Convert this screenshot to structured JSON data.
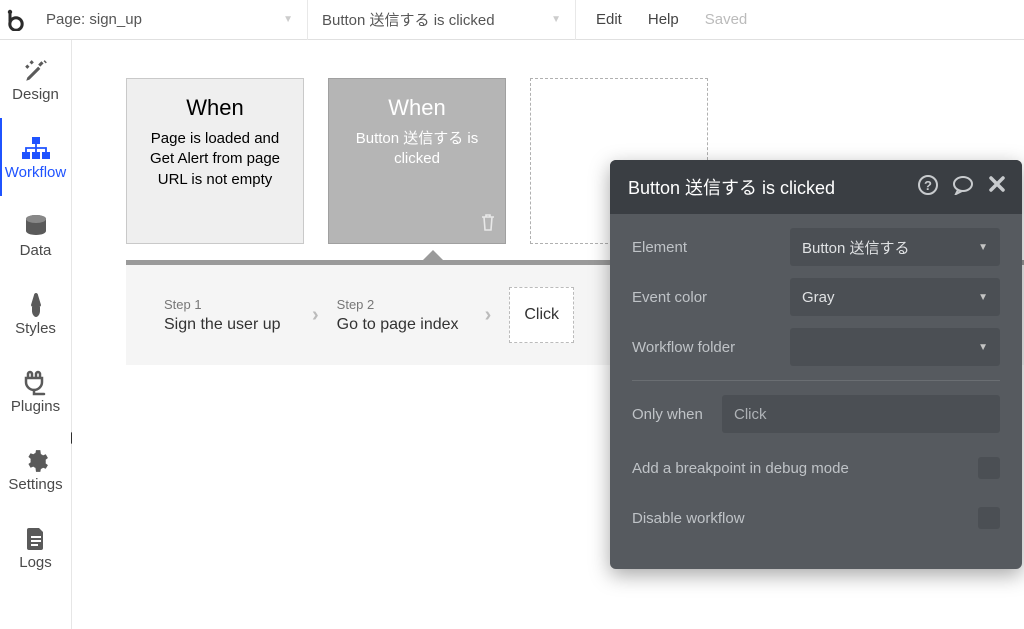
{
  "topbar": {
    "page_label": "Page: sign_up",
    "event_label": "Button 送信する is clicked",
    "edit": "Edit",
    "help": "Help",
    "saved": "Saved"
  },
  "sidebar": {
    "design": "Design",
    "workflow": "Workflow",
    "data": "Data",
    "styles": "Styles",
    "plugins": "Plugins",
    "settings": "Settings",
    "logs": "Logs"
  },
  "events": {
    "card1_when": "When",
    "card1_desc": "Page is loaded and Get Alert from page URL is not empty",
    "card2_when": "When",
    "card2_desc": "Button 送信する is clicked"
  },
  "steps": {
    "s1_label": "Step 1",
    "s1_text": "Sign the user up",
    "s2_label": "Step 2",
    "s2_text": "Go to page index",
    "empty": "Click"
  },
  "panel": {
    "title": "Button 送信する is clicked",
    "element_label": "Element",
    "element_value": "Button 送信する",
    "eventcolor_label": "Event color",
    "eventcolor_value": "Gray",
    "folder_label": "Workflow folder",
    "folder_value": "",
    "onlywhen_label": "Only when",
    "onlywhen_placeholder": "Click",
    "breakpoint_label": "Add a breakpoint in debug mode",
    "disable_label": "Disable workflow"
  }
}
